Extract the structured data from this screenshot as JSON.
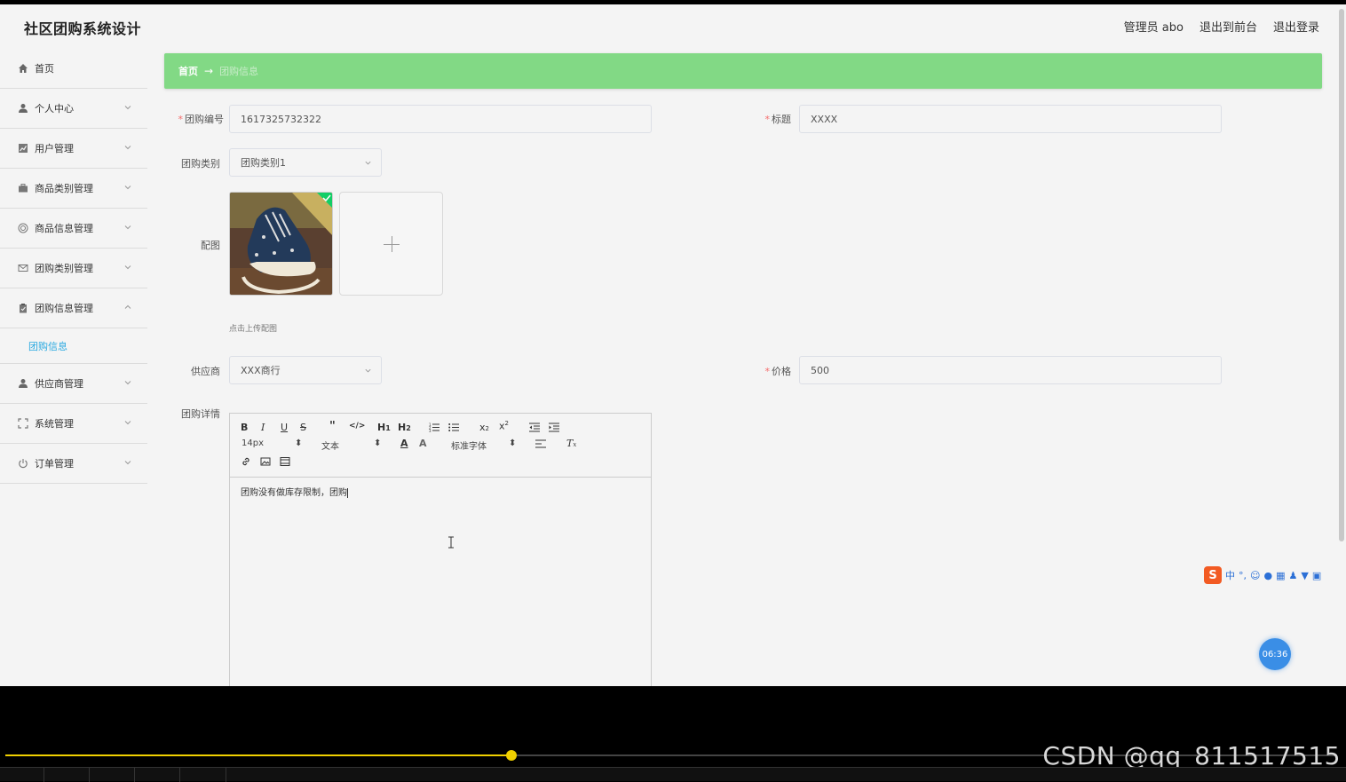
{
  "header": {
    "title": "社区团购系统设计",
    "admin": "管理员 abo",
    "exit_front": "退出到前台",
    "logout": "退出登录"
  },
  "sidebar": {
    "items": [
      {
        "label": "首页",
        "icon": "home-icon"
      },
      {
        "label": "个人中心",
        "icon": "user-icon"
      },
      {
        "label": "用户管理",
        "icon": "chart-icon"
      },
      {
        "label": "商品类别管理",
        "icon": "briefcase-icon"
      },
      {
        "label": "商品信息管理",
        "icon": "circle-icon"
      },
      {
        "label": "团购类别管理",
        "icon": "mail-icon"
      },
      {
        "label": "团购信息管理",
        "icon": "clipboard-icon"
      },
      {
        "label": "供应商管理",
        "icon": "user-icon"
      },
      {
        "label": "系统管理",
        "icon": "fullscreen-icon"
      },
      {
        "label": "订单管理",
        "icon": "power-icon"
      }
    ],
    "active_sub": "团购信息"
  },
  "breadcrumb": {
    "home": "首页",
    "sep": "→",
    "current": "团购信息"
  },
  "form": {
    "code_label": "团购编号",
    "code_value": "1617325732322",
    "title_label": "标题",
    "title_value": "XXXX",
    "category_label": "团购类别",
    "category_value": "团购类别1",
    "image_label": "配图",
    "upload_hint": "点击上传配图",
    "supplier_label": "供应商",
    "supplier_value": "XXX商行",
    "price_label": "价格",
    "price_value": "500",
    "detail_label": "团购详情"
  },
  "editor": {
    "size": "14px",
    "format": "文本",
    "font": "标准字体",
    "content": "团购没有做库存限制，团购"
  },
  "overlay": {
    "ime_cn": "中",
    "clock": "06:36",
    "watermark": "CSDN @qq_811517515"
  },
  "player": {
    "progress": 0.38
  },
  "colors": {
    "breadcrumb_bg": "#82d985",
    "active_link": "#2aa9e0",
    "required": "#f56c6c",
    "progress": "#f0d000"
  }
}
